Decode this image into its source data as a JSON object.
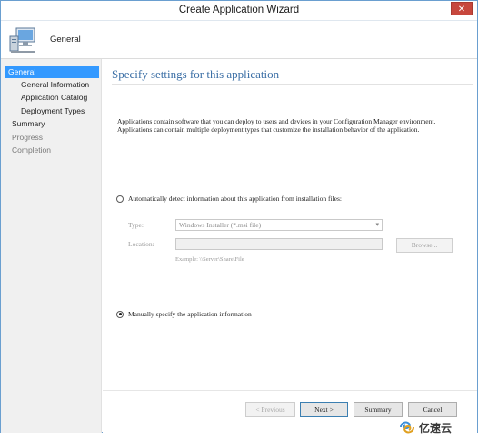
{
  "window": {
    "title": "Create Application Wizard",
    "close_glyph": "✕"
  },
  "header": {
    "title": "General",
    "icon": "computer-monitor-icon"
  },
  "nav": {
    "items": [
      {
        "label": "General",
        "state": "active"
      },
      {
        "label": "General Information",
        "state": "sub"
      },
      {
        "label": "Application Catalog",
        "state": "sub"
      },
      {
        "label": "Deployment Types",
        "state": "sub"
      },
      {
        "label": "Summary",
        "state": "normal"
      },
      {
        "label": "Progress",
        "state": "dim"
      },
      {
        "label": "Completion",
        "state": "dim"
      }
    ]
  },
  "main": {
    "heading": "Specify settings for this application",
    "description": "Applications contain software that you can deploy to users and devices in your Configuration Manager environment. Applications can contain multiple deployment types that customize the installation behavior of the application.",
    "auto_detect": {
      "label": "Automatically detect information about this application from installation files:",
      "checked": false,
      "type_label": "Type:",
      "type_value": "Windows Installer (*.msi file)",
      "location_label": "Location:",
      "location_value": "",
      "browse_label": "Browse...",
      "example": "Example: \\\\Server\\Share\\File"
    },
    "manual": {
      "label": "Manually specify the application information",
      "checked": true
    }
  },
  "footer": {
    "previous": "< Previous",
    "next": "Next >",
    "summary": "Summary",
    "cancel": "Cancel"
  },
  "watermark": {
    "text": "亿速云"
  },
  "colors": {
    "nav_active": "#3399ff",
    "heading": "#3a6ea5",
    "close_button": "#c7473d"
  }
}
